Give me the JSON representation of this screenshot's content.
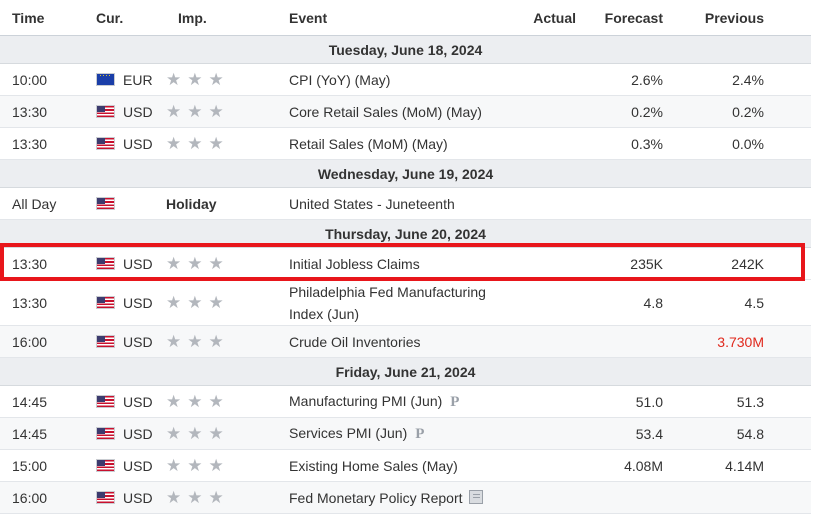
{
  "headers": {
    "time": "Time",
    "cur": "Cur.",
    "imp": "Imp.",
    "event": "Event",
    "actual": "Actual",
    "forecast": "Forecast",
    "previous": "Previous"
  },
  "days": [
    {
      "label": "Tuesday, June 18, 2024"
    },
    {
      "label": "Wednesday, June 19, 2024"
    },
    {
      "label": "Thursday, June 20, 2024"
    },
    {
      "label": "Friday, June 21, 2024"
    }
  ],
  "rows": [
    {
      "time": "10:00",
      "cur": "EUR",
      "event": "CPI (YoY) (May)",
      "actual": "",
      "forecast": "2.6%",
      "previous": "2.4%"
    },
    {
      "time": "13:30",
      "cur": "USD",
      "event": "Core Retail Sales (MoM) (May)",
      "actual": "",
      "forecast": "0.2%",
      "previous": "0.2%"
    },
    {
      "time": "13:30",
      "cur": "USD",
      "event": "Retail Sales (MoM) (May)",
      "actual": "",
      "forecast": "0.3%",
      "previous": "0.0%"
    },
    {
      "time": "All Day",
      "cur": "",
      "imp": "Holiday",
      "event": "United States - Juneteenth",
      "actual": "",
      "forecast": "",
      "previous": ""
    },
    {
      "time": "13:30",
      "cur": "USD",
      "event": "Initial Jobless Claims",
      "actual": "",
      "forecast": "235K",
      "previous": "242K"
    },
    {
      "time": "13:30",
      "cur": "USD",
      "event_line1": "Philadelphia Fed Manufacturing",
      "event_line2": "Index (Jun)",
      "actual": "",
      "forecast": "4.8",
      "previous": "4.5"
    },
    {
      "time": "16:00",
      "cur": "USD",
      "event": "Crude Oil Inventories",
      "actual": "",
      "forecast": "",
      "previous": "3.730M"
    },
    {
      "time": "14:45",
      "cur": "USD",
      "event": "Manufacturing PMI (Jun)",
      "badge": "P",
      "actual": "",
      "forecast": "51.0",
      "previous": "51.3"
    },
    {
      "time": "14:45",
      "cur": "USD",
      "event": "Services PMI (Jun)",
      "badge": "P",
      "actual": "",
      "forecast": "53.4",
      "previous": "54.8"
    },
    {
      "time": "15:00",
      "cur": "USD",
      "event": "Existing Home Sales (May)",
      "actual": "",
      "forecast": "4.08M",
      "previous": "4.14M"
    },
    {
      "time": "16:00",
      "cur": "USD",
      "event": "Fed Monetary Policy Report",
      "actual": "",
      "forecast": "",
      "previous": ""
    }
  ],
  "colors": {
    "highlight": "#e8161b",
    "negative_previous": "#e0291d",
    "star": "#b3b7bd",
    "day_band": "#eceef1"
  },
  "icons": {
    "importance": "star-icon",
    "preliminary": "preliminary-icon",
    "report": "report-icon",
    "flag_us": "us-flag-icon",
    "flag_eu": "eu-flag-icon"
  }
}
